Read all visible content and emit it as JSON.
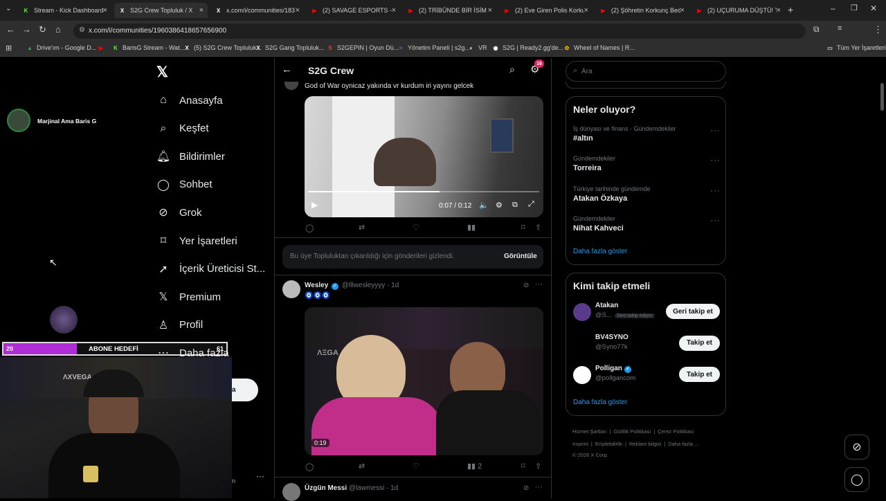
{
  "browser": {
    "tabs": [
      {
        "label": "Stream - Kick Dashboard",
        "fav": "K",
        "favColor": "#53fc18"
      },
      {
        "label": "S2G Crew Topluluk / X",
        "fav": "X",
        "favColor": "#ffffff",
        "active": true
      },
      {
        "label": "x.com/i/communities/183",
        "fav": "X",
        "favColor": "#ffffff"
      },
      {
        "label": "(2) SAVAGE ESPORTS - EV",
        "fav": "▶",
        "favColor": "#ff0000"
      },
      {
        "label": "(2) TRİBÜNDE BİR İSİM | M",
        "fav": "▶",
        "favColor": "#ff0000"
      },
      {
        "label": "(2) Eve Giren Polis Korkun",
        "fav": "▶",
        "favColor": "#ff0000"
      },
      {
        "label": "(2) Şöhretin Korkunç Bede",
        "fav": "▶",
        "favColor": "#ff0000"
      },
      {
        "label": "(2) UÇURUMA DÜŞTÜ! Tu",
        "fav": "▶",
        "favColor": "#ff0000"
      }
    ],
    "url": "x.com/i/communities/1960386418657656900",
    "bookmarks": [
      {
        "label": "Drive'ım - Google D...",
        "icon": "▲",
        "color": "#34a853"
      },
      {
        "label": "",
        "icon": "▶",
        "color": "#ff0000"
      },
      {
        "label": "BarisG Stream - Wat...",
        "icon": "K",
        "color": "#53fc18"
      },
      {
        "label": "(5) S2G Crew Topluluk...",
        "icon": "X",
        "color": "#ffffff"
      },
      {
        "label": "S2G Gang Topluluk...",
        "icon": "X",
        "color": "#ffffff"
      },
      {
        "label": "S2GEPIN | Oyun Dü...",
        "icon": "S",
        "color": "#e04040"
      },
      {
        "label": "Yönetim Paneli | s2g...",
        "icon": "≈",
        "color": "#9b59b6"
      },
      {
        "label": "VR",
        "icon": "◐",
        "color": "#ffffff"
      },
      {
        "label": "S2G | Ready2.gg'de...",
        "icon": "◉",
        "color": "#ffffff"
      },
      {
        "label": "Wheel of Names | R...",
        "icon": "✿",
        "color": "#f4b400"
      }
    ],
    "all_bookmarks": "Tüm Yer İşaretleri"
  },
  "stream_overlay": {
    "streamer_name": "Marjinal Ama Baris G",
    "goal_label": "ABONE HEDEFİ",
    "goal_current": "20",
    "goal_target": "61",
    "goal_progress": 0.33
  },
  "sidebar": {
    "items": [
      {
        "label": "Anasayfa",
        "icon": "home-icon"
      },
      {
        "label": "Keşfet",
        "icon": "search-icon"
      },
      {
        "label": "Bildirimler",
        "icon": "bell-icon"
      },
      {
        "label": "Sohbet",
        "icon": "chat-icon"
      },
      {
        "label": "Grok",
        "icon": "grok-icon"
      },
      {
        "label": "Yer İşaretleri",
        "icon": "bookmark-icon"
      },
      {
        "label": "İçerik Üreticisi St...",
        "icon": "rocket-icon"
      },
      {
        "label": "Premium",
        "icon": "x-logo-icon"
      },
      {
        "label": "Profil",
        "icon": "person-icon"
      },
      {
        "label": "Daha fazla",
        "icon": "more-circle-icon"
      }
    ]
  },
  "header": {
    "title": "S2G Crew",
    "notif_badge": "16"
  },
  "posts": [
    {
      "text": "God of War oynicaz yakında vr kurdum iri yayını gelcek",
      "video_time": "0:07 / 0:12",
      "video_progress": 0.57,
      "views": ""
    },
    {
      "author": "Wesley",
      "handle": "@lllwesleyyyy",
      "time": "· 1d",
      "emojis": "🧿🧿🧿",
      "video_duration": "0:19",
      "views": "2"
    },
    {
      "author": "Üzgün Messi",
      "handle": "@lawmessi",
      "time": "· 1d"
    }
  ],
  "hidden_notice": {
    "text": "Bu üye Topluluktan çıkarıldığı için gönderileri gizlendi.",
    "button": "Görüntüle"
  },
  "search": {
    "placeholder": "Ara"
  },
  "trends": {
    "title": "Neler oluyor?",
    "items": [
      {
        "meta": "İş dünyası ve finans · Gündemdekiler",
        "name": "#altın"
      },
      {
        "meta": "Gündemdekiler",
        "name": "Torreira"
      },
      {
        "meta": "Türkiye tarihinde gündemde",
        "name": "Atakan Özkaya"
      },
      {
        "meta": "Gündemdekiler",
        "name": "Nihat Kahveci"
      }
    ],
    "more": "Daha fazla göster"
  },
  "who_to_follow": {
    "title": "Kimi takip etmeli",
    "items": [
      {
        "name": "Atakan",
        "handle": "@S...",
        "badge": "Seni takip ediyor",
        "button": "Geri takip et",
        "verified": false
      },
      {
        "name": "BV4SYNO",
        "handle": "@Syno77k",
        "badge": "",
        "button": "Takip et",
        "verified": false
      },
      {
        "name": "Polligan",
        "handle": "@pollgancom",
        "badge": "",
        "button": "Takip et",
        "verified": true
      }
    ],
    "more": "Daha fazla göster"
  },
  "footer": {
    "links": [
      "Hizmet Şartları",
      "Gizlilik Politikası",
      "Çerez Politikası",
      "Imprint",
      "Erişilebilirlik",
      "Reklam bilgisi",
      "Daha fazla ..."
    ],
    "copyright": "© 2026 X Corp."
  },
  "colors": {
    "accent": "#1d9bf0",
    "goal_fill": "#b02cd6"
  }
}
